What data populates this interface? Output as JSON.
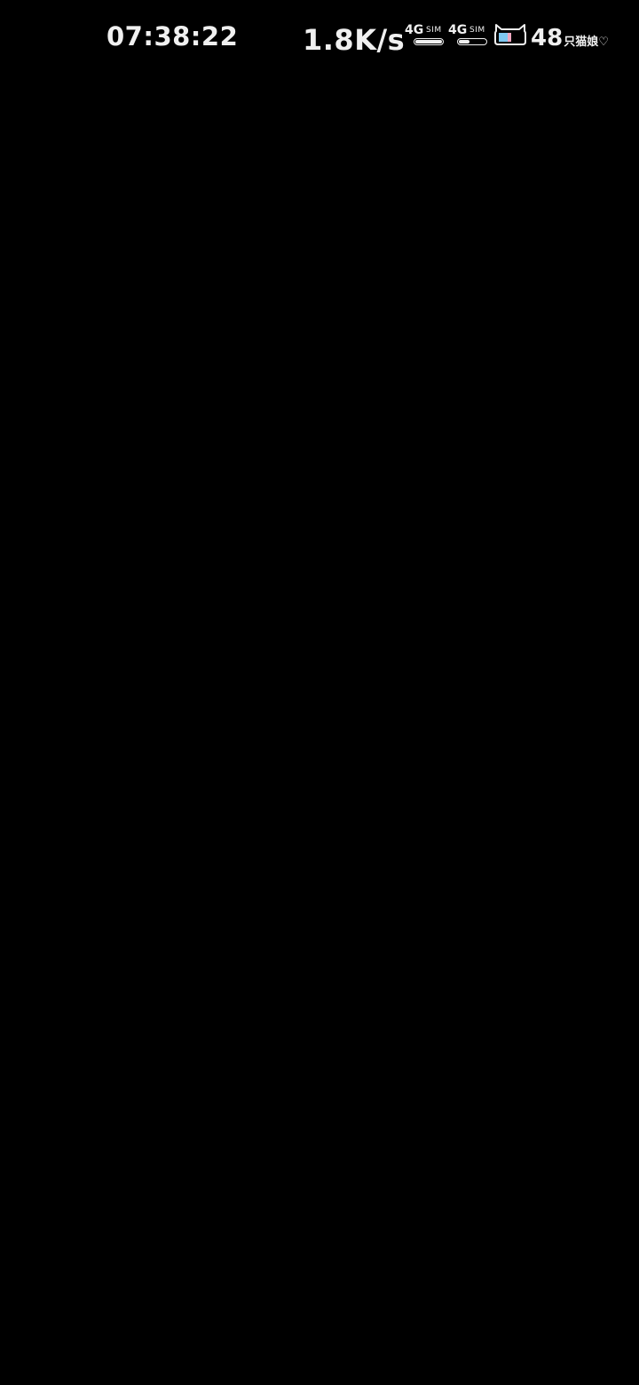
{
  "status_bar": {
    "time": "07:38:22",
    "network_speed": "1.8K/s",
    "sim1": {
      "network_type": "4G",
      "label": "SIM",
      "signal_level": 1.0
    },
    "sim2": {
      "network_type": "4G",
      "label": "SIM",
      "signal_level": 0.4
    },
    "battery": {
      "icon": "cat-battery-icon",
      "level": "48",
      "suffix": "只猫娘♡"
    }
  },
  "colors": {
    "background": "#000000",
    "foreground": "#f0f0f0",
    "cat_accent_blue": "#7fc8f0",
    "cat_accent_pink": "#f0a8c0"
  }
}
